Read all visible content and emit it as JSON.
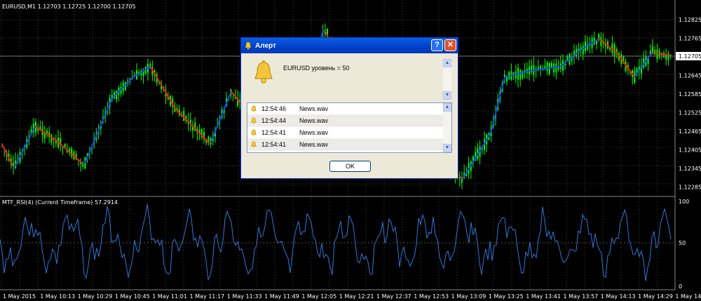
{
  "main_chart": {
    "label": "EURUSD,M1  1.12703 1.12725 1.12700 1.12705",
    "price_ticks": [
      "1.12825",
      "1.12765",
      "1.12705",
      "1.12645",
      "1.12585",
      "1.12525",
      "1.12465",
      "1.12405",
      "1.12345",
      "1.12285"
    ],
    "current_price": "1.12705"
  },
  "indicator": {
    "label": "MTF_RSI(4) (Current Timeframe) 57.2914",
    "level_ticks": [
      "100",
      "50",
      "0"
    ]
  },
  "time_axis": [
    "1 May 2015",
    "1 May 10:13",
    "1 May 10:29",
    "1 May 10:45",
    "1 May 11:01",
    "1 May 11:17",
    "1 May 11:33",
    "1 May 11:49",
    "1 May 12:05",
    "1 May 12:21",
    "1 May 12:37",
    "1 May 12:53",
    "1 May 13:09",
    "1 May 13:25",
    "1 May 13:41",
    "1 May 13:57",
    "1 May 14:13",
    "1 May 14:29",
    "1 May 14:45"
  ],
  "colors": {
    "bull": "#00ff00",
    "bear": "#00ff00",
    "ma_up": "#1a3cff",
    "ma_down": "#ff1010",
    "rsi": "#2e78d8",
    "grid": "#2c3a2c"
  },
  "alert_dialog": {
    "title": "Алерт",
    "message": "EURUSD уровень = 50",
    "help_label": "?",
    "close_label": "✕",
    "ok_label": "OK",
    "rows": [
      {
        "time": "12:54:46",
        "file": "News.wav"
      },
      {
        "time": "12:54:44",
        "file": "News.wav"
      },
      {
        "time": "12:54:41",
        "file": "News.wav"
      },
      {
        "time": "12:54:41",
        "file": "News.wav"
      }
    ]
  }
}
